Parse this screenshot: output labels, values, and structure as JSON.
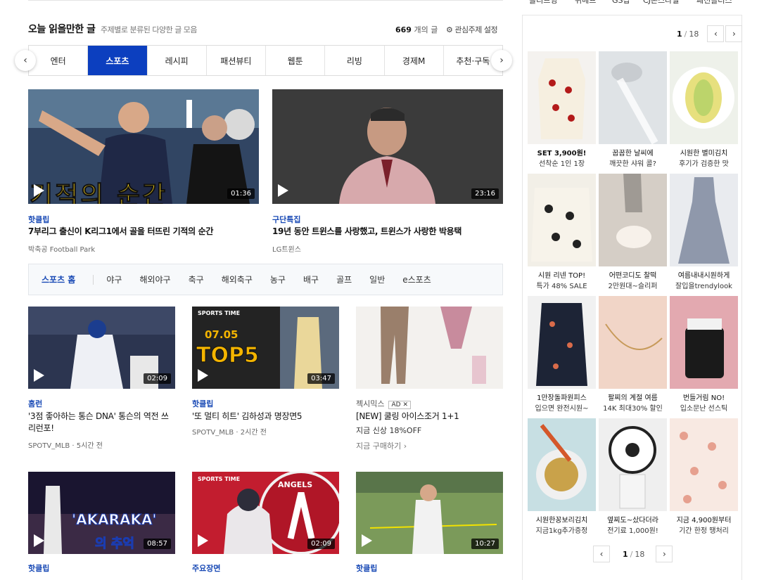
{
  "top_strip": [
    "올리브영",
    "위메프",
    "GS샵",
    "CJ온스타일",
    "패션플러스"
  ],
  "section": {
    "title": "오늘 읽을만한 글",
    "subtitle": "주제별로 분류된 다양한 글 모음",
    "count_num": "669",
    "count_unit": " 개의 글",
    "setting_label": "관심주제 설정"
  },
  "tabs": [
    "엔터",
    "스포츠",
    "레시피",
    "패션뷰티",
    "웹툰",
    "리빙",
    "경제M",
    "추천·구독"
  ],
  "active_tab": "스포츠",
  "featured": [
    {
      "category": "핫클립",
      "title": "7부리그 출신이 K리그1에서 골을 터뜨린 기적의 순간",
      "source": "박축공 Football Park",
      "duration": "01:36",
      "caption": "기적의 순간"
    },
    {
      "category": "구단특집",
      "title": "19년 동안 트윈스를 사랑했고, 트윈스가 사랑한 박용택",
      "source": "LG트윈스",
      "duration": "23:16"
    }
  ],
  "subnav": [
    "스포츠 홈",
    "야구",
    "해외야구",
    "축구",
    "해외축구",
    "농구",
    "배구",
    "골프",
    "일반",
    "e스포츠"
  ],
  "cards": [
    {
      "category": "홈런",
      "title": "'3점 좋아하는 통슨 DNA' 통슨의 역전 쓰리런포!",
      "source": "SPOTV_MLB · 5시간 전",
      "duration": "02:09"
    },
    {
      "category": "핫클립",
      "title": "'또 멀티 히트' 김하성과 명장면5",
      "source": "SPOTV_MLB · 2시간 전",
      "duration": "03:47",
      "img_text1": "SPORTS TIME",
      "img_text2": "07.05",
      "img_text3": "TOP5"
    },
    {
      "category": "젝시믹스",
      "ad_label": "AD",
      "title": "[NEW] 쿨링 아이스조거 1+1",
      "source": "지금 신상 18%OFF",
      "extra": "지금 구매하기 ›"
    },
    {
      "category": "핫클립",
      "title": "",
      "duration": "08:57",
      "img_text1": "'AKARAKA'",
      "img_text2": "의 추억"
    },
    {
      "category": "주요장면",
      "title": "",
      "duration": "02:09",
      "img_text1": "SPORTS TIME",
      "img_text2": "ANGELS"
    },
    {
      "category": "핫클립",
      "title": "",
      "duration": "10:27"
    }
  ],
  "shop": {
    "page": "1",
    "total": "18",
    "items": [
      {
        "t1": "SET 3,900원!",
        "t2": "선착순 1인 1장"
      },
      {
        "t1": "꿉꿉한 날씨에",
        "t2": "깨끗한 샤워 콜?"
      },
      {
        "t1": "시원한 별미김치",
        "t2": "후기가 검증한 맛"
      },
      {
        "t1": "시원 리넨 TOP!",
        "t2": "특가 48% SALE"
      },
      {
        "t1": "어떤코디도 찰떡",
        "t2": "2만원대~슬리퍼"
      },
      {
        "t1": "여름내내시원하게",
        "t2": "잘입을trendylook"
      },
      {
        "t1": "1만장돌파원피스",
        "t2": "입으면 완전시원~"
      },
      {
        "t1": "팔찌의 계절 여름",
        "t2": "14K 최대30% 할인"
      },
      {
        "t1": "번들거림 NO!",
        "t2": "입소문난 선스틱"
      },
      {
        "t1": "시원한꽁보리김치",
        "t2": "지금1kg추가증정"
      },
      {
        "t1": "옆찌도~샀다더라",
        "t2": "전기료 1,000원!"
      },
      {
        "t1": "지금 4,900원부터",
        "t2": "기간 한정 땡처리"
      }
    ]
  },
  "colors": {
    "accent": "#0c3fbf",
    "link": "#1849b5"
  }
}
